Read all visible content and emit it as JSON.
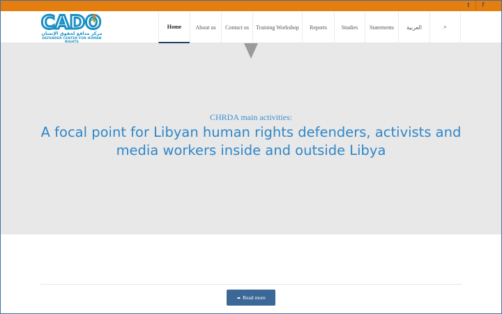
{
  "topbar": {
    "social": [
      {
        "icon": "twitter-icon",
        "glyph": "t"
      },
      {
        "icon": "facebook-icon",
        "glyph": "f"
      }
    ]
  },
  "logo": {
    "mark_text": "CADO",
    "arabic_name": "مركز مدافع لحقوق الإنسان",
    "english_name": "DEFENDER CENTER FOR HUMAN RIGHTS"
  },
  "nav": {
    "items": [
      {
        "label": "Home"
      },
      {
        "label": "About us"
      },
      {
        "label": "Contact us"
      },
      {
        "label": "Training Workshop"
      },
      {
        "label": "Reports"
      },
      {
        "label": "Studies"
      },
      {
        "label": "Statements"
      },
      {
        "label": "العربية"
      }
    ],
    "search_glyph": "⌕"
  },
  "hero": {
    "subtitle": "CHRDA main activities:",
    "headline": "A focal point for Libyan human rights defenders, activists and media workers inside and outside Libya"
  },
  "read_more": {
    "label": "Read more",
    "icon_glyph": "☁"
  },
  "colors": {
    "topbar": "#e47e0f",
    "accent_blue": "#2f86c8",
    "button": "#3c6898",
    "hero_bg": "#e8e8e8"
  }
}
